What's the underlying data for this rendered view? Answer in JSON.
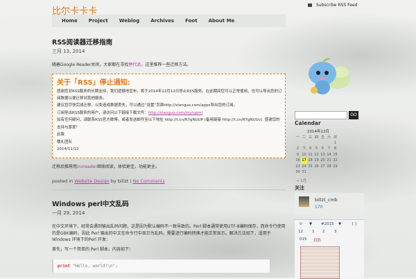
{
  "site": {
    "title": "比尔卡卡卡",
    "rss_link": "Subscribe RSS Feed"
  },
  "nav": [
    "Home",
    "Project",
    "Weblog",
    "Archives",
    "Foot",
    "About Me"
  ],
  "post1": {
    "title": "RSS阅读器迁移指南",
    "date": "三月 13, 2014",
    "intro_before": "随着Google Reader关闭，大家都在寻找",
    "intro_link": "替代品",
    "intro_after": "，这里推荐一些迁移方法。",
    "notice_title": "关于「RSS」停止通知:",
    "notice_lines": [
      "感谢您对RSS服务的长期支持，我们遗憾地宣布，将于2014年12月12日停止RSS服务。在此期间您可以正常使用，也可以导出您的订阅数据以便迁移到其他服务。",
      "建议您尽快完成迁移，以免造成数据丢失，可以通过“设置”页面http://xianguo.com/apps导出您的订阅。",
      "订阅导出RSS服务的用户，请访问以下链接下载文件：",
      "如有任何疑问，请联系RSS官方微博，或者发送邮件至以下地址 http://t.cn/R7gNUUP (备用链接 http://t.cn/R7gNUUv). 感谢您的支持与厚爱！",
      "此致",
      "敬礼团队",
      "2014/11/12"
    ],
    "notice_link": "http://xianguo.com/my/opml",
    "outro_before": "迁移后推荐用",
    "outro_link": "inoreader",
    "outro_after": "继续阅读，体验更佳，功能更全。",
    "meta_prefix": "posted in",
    "meta_category": "Website Design",
    "meta_by": "by billzt",
    "meta_comments": "No Comments"
  },
  "post2": {
    "title": "Windows perl中文乱码",
    "date": "一月 29, 2014",
    "body1": "在中文环境下，经常会遇到输出乱码问题，这是因为默认编码不一致导致的。Perl 脚本通常使用UTF-8编码保存，而命令行使用的是GBK编码，因此 Perl 输出的中文在命令行中显示为乱码，需要进行编码转换才能正常显示。解决方法如下，适用于 Windows 环境下的Perl 开发：",
    "body2": "首先，写一个简单的 Perl 脚本，内容如下：",
    "code_kw": "print",
    "code_str": "\"Hello, world!\\n\";"
  },
  "sidebar": {
    "search_button": "GO",
    "search_placeholder": "",
    "calendar_title": "Calendar",
    "calendar_month": "2014年12月",
    "calendar_head": [
      "一",
      "二",
      "三",
      "四",
      "五",
      "六",
      "日"
    ],
    "calendar_rows": [
      [
        "",
        "",
        "",
        "",
        "",
        "",
        "1"
      ],
      [
        "2",
        "3",
        "4",
        "5",
        "6",
        "7",
        "8"
      ],
      [
        "9",
        "10",
        "11",
        "12",
        "13",
        "14",
        "15"
      ],
      [
        "16",
        "17",
        "18",
        "19",
        "20",
        "21",
        "22"
      ],
      [
        "23",
        "24",
        "25",
        "26",
        "27",
        "28",
        "29"
      ],
      [
        "30",
        "31",
        "",
        "",
        "",
        "",
        ""
      ]
    ],
    "calendar_highlight": "17",
    "calendar_prev": "« 1月",
    "widget_title": "关注",
    "widget_user": "billzt_cmb",
    "widget_count": "170",
    "toolbar_row1": [
      "V",
      "▼",
      "#2015",
      "▼",
      "[ ]"
    ],
    "toolbar_row2": [
      "12",
      "1",
      "2",
      "3"
    ],
    "toolbar_row3": [
      "015",
      "日历"
    ]
  },
  "colors": {
    "accent": "#e07b18",
    "link": "#b13fa4",
    "highlight": "#f6ef3c"
  }
}
